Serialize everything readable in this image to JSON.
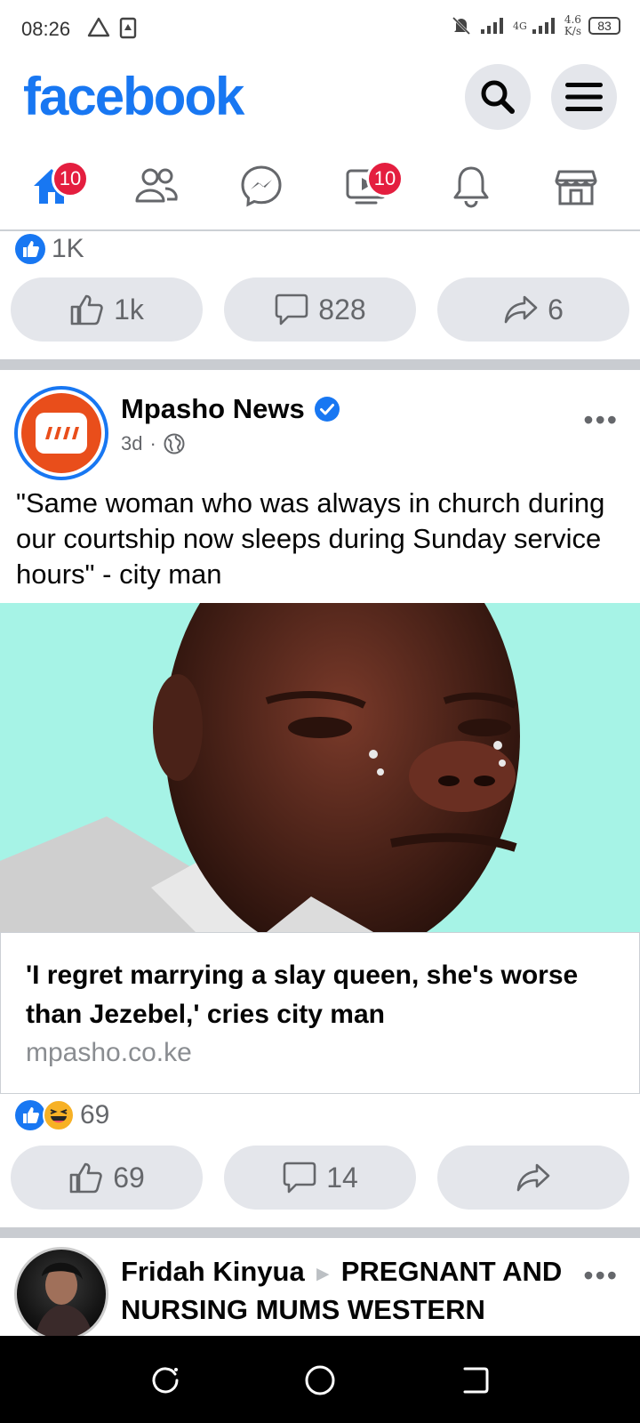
{
  "status_bar": {
    "time": "08:26",
    "network_type": "4G",
    "net_speed_value": "4.6",
    "net_speed_unit": "K/s",
    "battery": "83"
  },
  "header": {
    "logo": "facebook",
    "brand_color": "#1877f2"
  },
  "tabs": [
    {
      "name": "home",
      "icon": "home-icon",
      "badge": "10",
      "active": true
    },
    {
      "name": "friends",
      "icon": "friends-icon",
      "badge": ""
    },
    {
      "name": "messenger",
      "icon": "messenger-icon",
      "badge": ""
    },
    {
      "name": "watch",
      "icon": "video-icon",
      "badge": "10"
    },
    {
      "name": "notifications",
      "icon": "bell-icon",
      "badge": ""
    },
    {
      "name": "marketplace",
      "icon": "marketplace-icon",
      "badge": ""
    }
  ],
  "prev_post": {
    "reaction_count": "1K",
    "like_count": "1k",
    "comment_count": "828",
    "share_count": "6"
  },
  "post": {
    "author": "Mpasho News",
    "verified": true,
    "time": "3d",
    "separator": "·",
    "text": "\"Same woman who was always in church during our courtship now sleeps during Sunday service hours\" -  city man",
    "link_title": "'I regret marrying a slay queen, she's worse than Jezebel,' cries city man",
    "link_domain": "mpasho.co.ke",
    "reaction_count": "69",
    "like_count": "69",
    "comment_count": "14",
    "share_count": ""
  },
  "next_post": {
    "author": "Fridah Kinyua",
    "group": "PREGNANT AND NURSING MUMS WESTERN"
  }
}
